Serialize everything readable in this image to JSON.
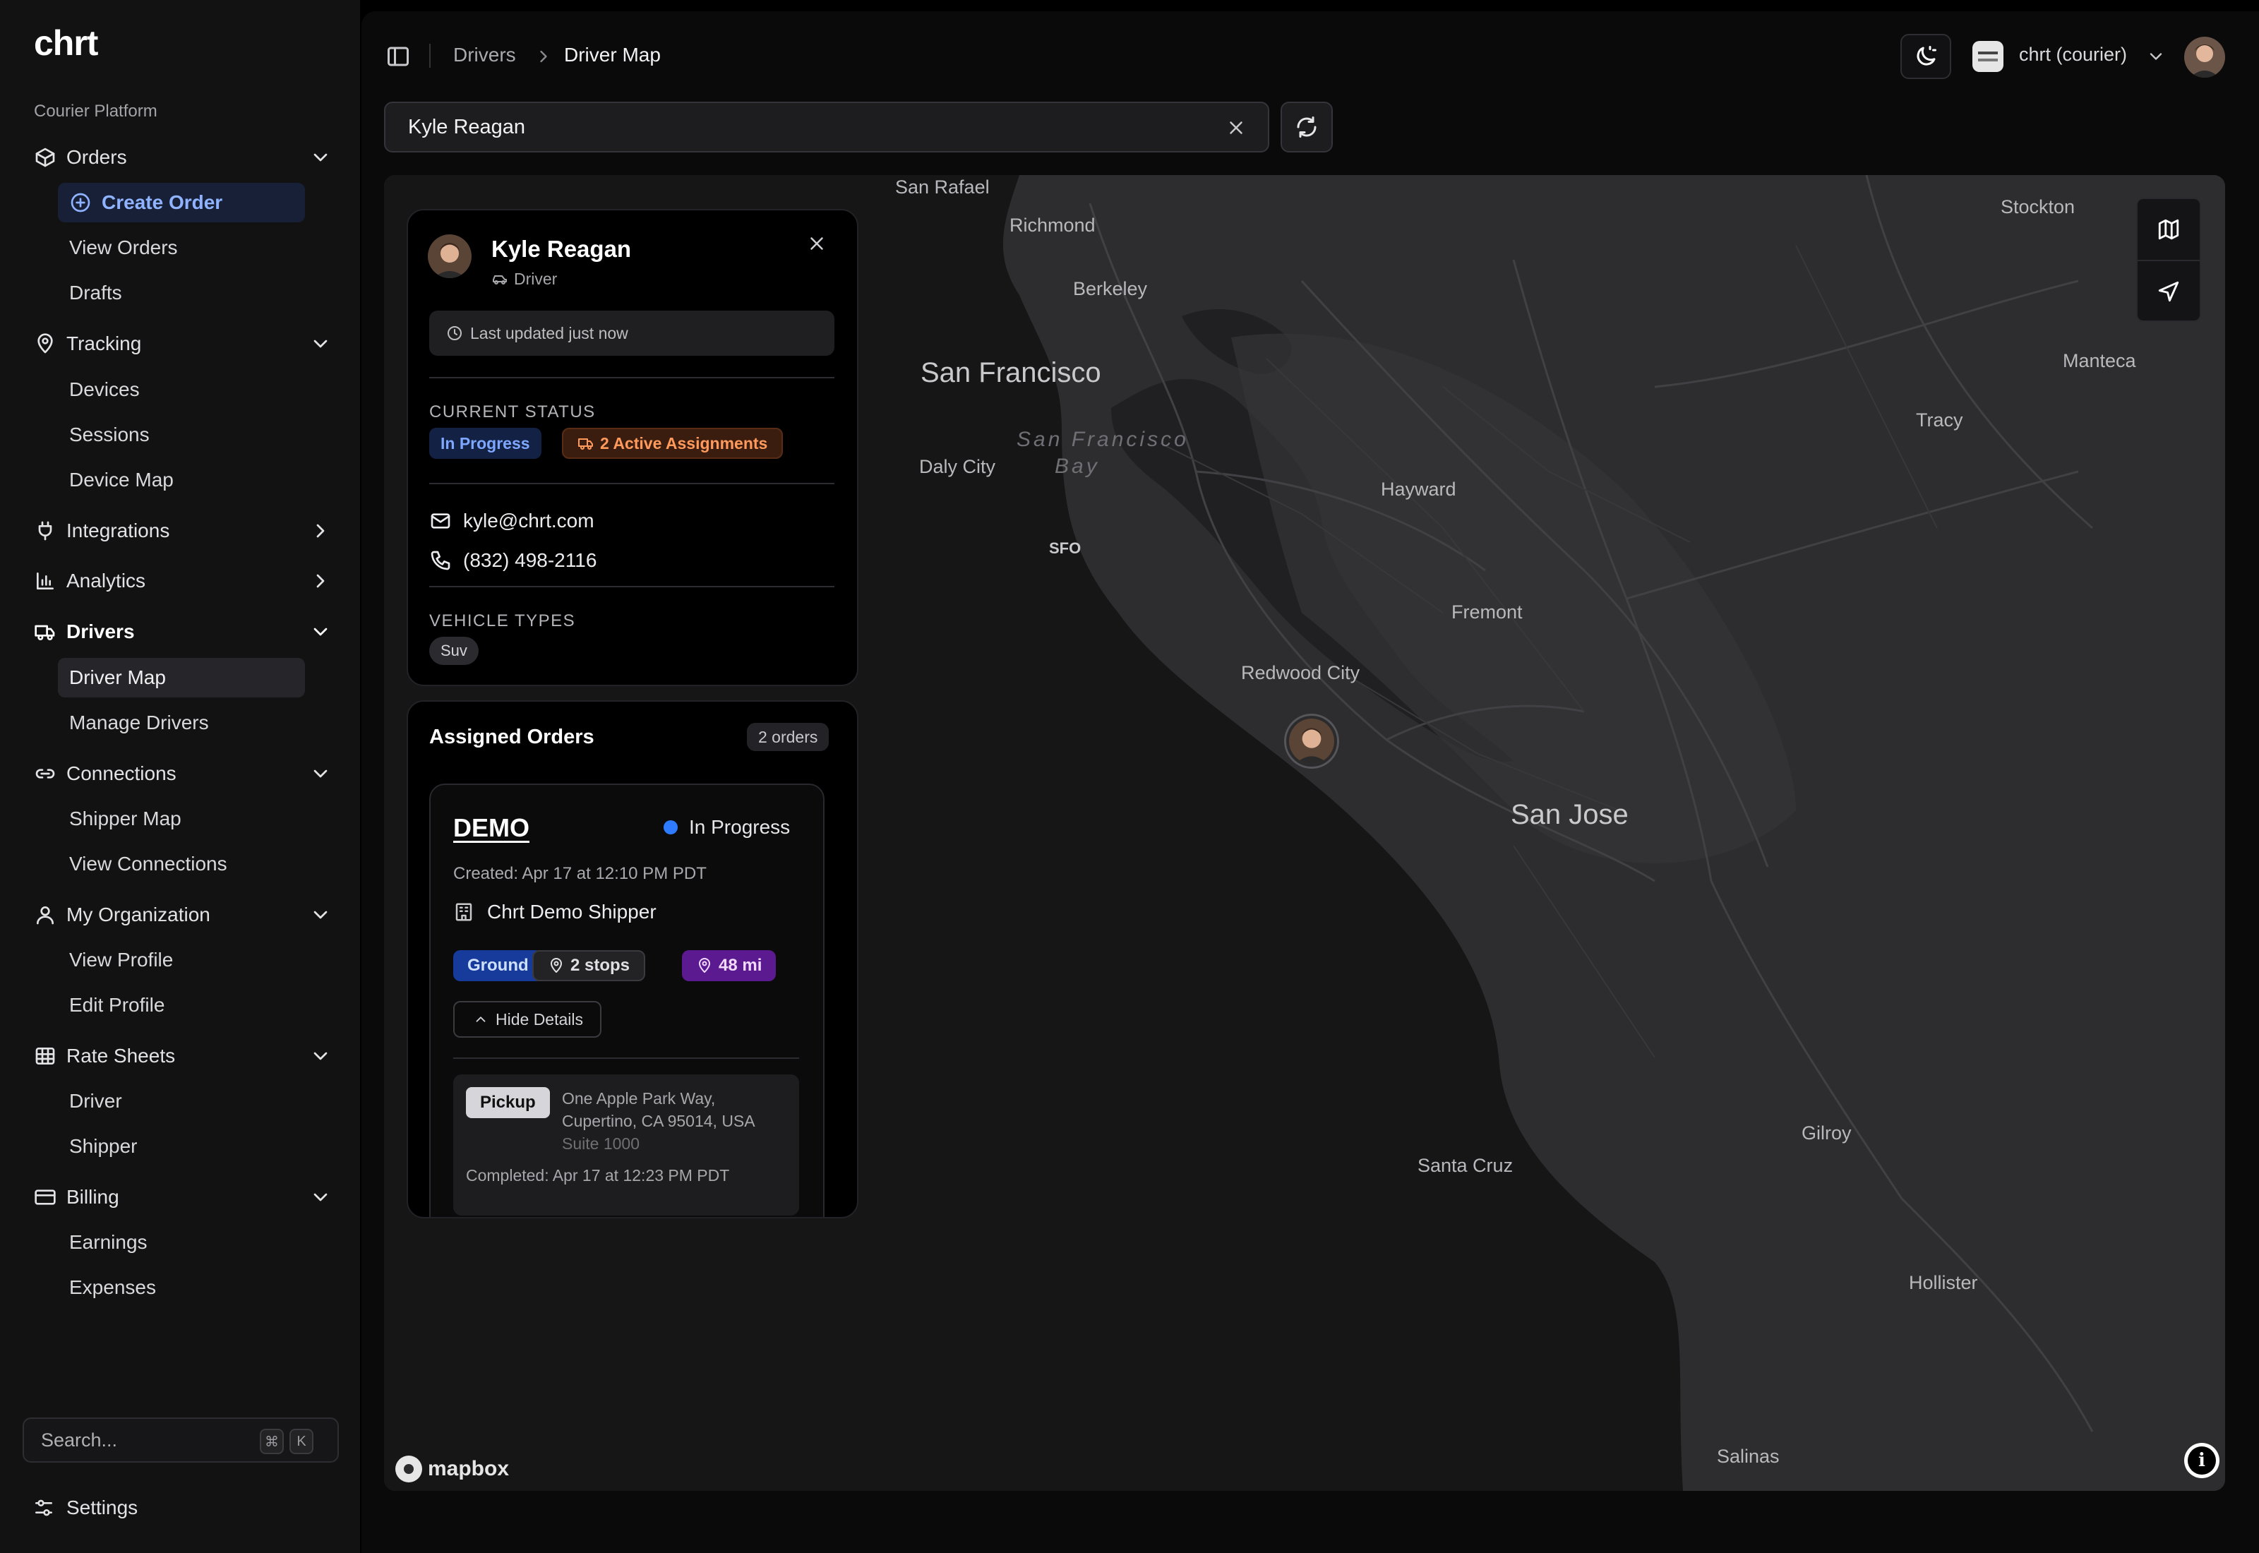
{
  "app": {
    "logo": "chrt",
    "section_label": "Courier Platform"
  },
  "sidebar": {
    "groups": [
      {
        "label": "Orders",
        "icon": "package-icon",
        "items": [
          "Create Order",
          "View Orders",
          "Drafts"
        ]
      },
      {
        "label": "Tracking",
        "icon": "map-pin-icon",
        "items": [
          "Devices",
          "Sessions",
          "Device Map"
        ]
      },
      {
        "label": "Integrations",
        "icon": "plug-icon",
        "items": []
      },
      {
        "label": "Analytics",
        "icon": "bar-chart-icon",
        "items": []
      },
      {
        "label": "Drivers",
        "icon": "truck-icon",
        "items": [
          "Driver Map",
          "Manage Drivers"
        ]
      },
      {
        "label": "Connections",
        "icon": "link-icon",
        "items": [
          "Shipper Map",
          "View Connections"
        ]
      },
      {
        "label": "My Organization",
        "icon": "user-icon",
        "items": [
          "View Profile",
          "Edit Profile"
        ]
      },
      {
        "label": "Rate Sheets",
        "icon": "table-icon",
        "items": [
          "Driver",
          "Shipper"
        ]
      },
      {
        "label": "Billing",
        "icon": "credit-card-icon",
        "items": [
          "Earnings",
          "Expenses"
        ]
      }
    ],
    "search_placeholder": "Search...",
    "search_kbd": [
      "⌘",
      "K"
    ],
    "settings_label": "Settings",
    "accent_color": "#8fb3ff"
  },
  "topbar": {
    "breadcrumb": [
      "Drivers",
      "Driver Map"
    ],
    "org_name": "chrt (courier)"
  },
  "search": {
    "value": "Kyle Reagan"
  },
  "map": {
    "labels": {
      "san_rafael": "San Rafael",
      "richmond": "Richmond",
      "berkeley": "Berkeley",
      "san_francisco": "San Francisco",
      "sf_bay_1": "San Francisco",
      "sf_bay_2": "Bay",
      "daly_city": "Daly City",
      "sfo": "SFO",
      "hayward": "Hayward",
      "fremont": "Fremont",
      "redwood_city": "Redwood City",
      "san_jose": "San Jose",
      "stockton": "Stockton",
      "manteca": "Manteca",
      "tracy": "Tracy",
      "gilroy": "Gilroy",
      "santa_cruz": "Santa Cruz",
      "hollister": "Hollister",
      "salinas": "Salinas"
    },
    "attribution": "mapbox",
    "info_glyph": "i"
  },
  "driver": {
    "name": "Kyle Reagan",
    "role": "Driver",
    "last_updated": "Last updated just now",
    "status_heading": "CURRENT STATUS",
    "status": "In Progress",
    "assignments": "2 Active Assignments",
    "email": "kyle@chrt.com",
    "phone": "(832) 498-2116",
    "vehicle_heading": "VEHICLE TYPES",
    "vehicle_types": [
      "Suv"
    ]
  },
  "orders": {
    "title": "Assigned Orders",
    "count": "2 orders",
    "items": [
      {
        "id": "DEMO",
        "status": "In Progress",
        "created": "Created: Apr 17 at 12:10 PM PDT",
        "shipper": "Chrt Demo Shipper",
        "service": "Ground",
        "stops": "2 stops",
        "distance": "48 mi",
        "toggle_label": "Hide Details",
        "stop": {
          "type": "Pickup",
          "address_line1": "One Apple Park Way,",
          "address_line2": "Cupertino, CA 95014, USA",
          "address_line3": "Suite 1000",
          "completed": "Completed: Apr 17 at 12:23 PM PDT"
        }
      }
    ]
  }
}
